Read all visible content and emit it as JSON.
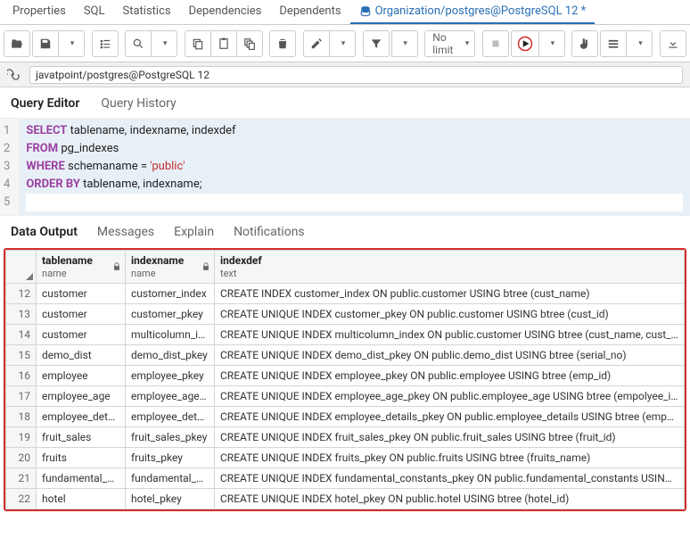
{
  "title_tab": "Organization/postgres@PostgreSQL 12 *",
  "top_tabs": [
    "Properties",
    "SQL",
    "Statistics",
    "Dependencies",
    "Dependents"
  ],
  "connection": "javatpoint/postgres@PostgreSQL 12",
  "limit_label": "No limit",
  "editor_tabs": {
    "query_editor": "Query Editor",
    "query_history": "Query History"
  },
  "code_lines": [
    {
      "n": "1",
      "kw": "SELECT",
      "rest": " tablename, indexname, indexdef"
    },
    {
      "n": "2",
      "kw": "FROM",
      "rest": " pg_indexes"
    },
    {
      "n": "3",
      "kw": "WHERE",
      "rest_pre": " schemaname = ",
      "str": "'public'",
      "rest_post": ""
    },
    {
      "n": "4",
      "kw": "ORDER BY",
      "rest": " tablename, indexname;"
    },
    {
      "n": "5",
      "kw": "",
      "rest": ""
    }
  ],
  "output_tabs": {
    "data_output": "Data Output",
    "messages": "Messages",
    "explain": "Explain",
    "notifications": "Notifications"
  },
  "columns": [
    {
      "name": "tablename",
      "type": "name",
      "lock": true
    },
    {
      "name": "indexname",
      "type": "name",
      "lock": true
    },
    {
      "name": "indexdef",
      "type": "text",
      "lock": false
    }
  ],
  "rows": [
    {
      "n": "12",
      "t": "customer",
      "i": "customer_index",
      "d": "CREATE INDEX customer_index ON public.customer USING btree (cust_name)"
    },
    {
      "n": "13",
      "t": "customer",
      "i": "customer_pkey",
      "d": "CREATE UNIQUE INDEX customer_pkey ON public.customer USING btree (cust_id)"
    },
    {
      "n": "14",
      "t": "customer",
      "i": "multicolumn_ind...",
      "d": "CREATE UNIQUE INDEX multicolumn_index ON public.customer USING btree (cust_name, cust_address, cus"
    },
    {
      "n": "15",
      "t": "demo_dist",
      "i": "demo_dist_pkey",
      "d": "CREATE UNIQUE INDEX demo_dist_pkey ON public.demo_dist USING btree (serial_no)"
    },
    {
      "n": "16",
      "t": "employee",
      "i": "employee_pkey",
      "d": "CREATE UNIQUE INDEX employee_pkey ON public.employee USING btree (emp_id)"
    },
    {
      "n": "17",
      "t": "employee_age",
      "i": "employee_age_p...",
      "d": "CREATE UNIQUE INDEX employee_age_pkey ON public.employee_age USING btree (empolyee_id)"
    },
    {
      "n": "18",
      "t": "employee_details",
      "i": "employee_detail...",
      "d": "CREATE UNIQUE INDEX employee_details_pkey ON public.employee_details USING btree (emp_id)"
    },
    {
      "n": "19",
      "t": "fruit_sales",
      "i": "fruit_sales_pkey",
      "d": "CREATE UNIQUE INDEX fruit_sales_pkey ON public.fruit_sales USING btree (fruit_id)"
    },
    {
      "n": "20",
      "t": "fruits",
      "i": "fruits_pkey",
      "d": "CREATE UNIQUE INDEX fruits_pkey ON public.fruits USING btree (fruits_name)"
    },
    {
      "n": "21",
      "t": "fundamental_co...",
      "i": "fundamental_co...",
      "d": "CREATE UNIQUE INDEX fundamental_constants_pkey ON public.fundamental_constants USING btre"
    },
    {
      "n": "22",
      "t": "hotel",
      "i": "hotel_pkey",
      "d": "CREATE UNIQUE INDEX hotel_pkey ON public.hotel USING btree (hotel_id)"
    }
  ]
}
